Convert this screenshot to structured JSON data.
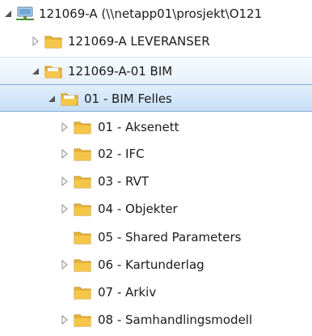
{
  "tree": {
    "root": {
      "label": "121069-A (\\\\netapp01\\prosjekt\\O121",
      "icon": "network-drive-icon",
      "state": "expanded"
    },
    "items": [
      {
        "label": "121069-A LEVERANSER",
        "icon": "folder-icon",
        "state": "collapsed"
      },
      {
        "label": "121069-A-01 BIM",
        "icon": "folder-open-icon",
        "state": "expanded"
      },
      {
        "label": "01 - BIM Felles",
        "icon": "folder-open-icon",
        "state": "expanded",
        "selected": true
      },
      {
        "label": "01 - Aksenett",
        "icon": "folder-icon",
        "state": "collapsed"
      },
      {
        "label": "02 - IFC",
        "icon": "folder-icon",
        "state": "collapsed"
      },
      {
        "label": "03 - RVT",
        "icon": "folder-icon",
        "state": "collapsed"
      },
      {
        "label": "04 - Objekter",
        "icon": "folder-icon",
        "state": "collapsed"
      },
      {
        "label": "05 - Shared Parameters",
        "icon": "folder-icon",
        "state": "none"
      },
      {
        "label": "06 - Kartunderlag",
        "icon": "folder-icon",
        "state": "collapsed"
      },
      {
        "label": "07 - Arkiv",
        "icon": "folder-icon",
        "state": "none"
      },
      {
        "label": "08 - Samhandlingsmodell",
        "icon": "folder-icon",
        "state": "collapsed"
      }
    ]
  },
  "colors": {
    "selection_fill": "#c6dff6",
    "selection_border": "#84acdd",
    "folder_yellow": "#f4c64a",
    "expander_gray": "#8c8c8c"
  }
}
